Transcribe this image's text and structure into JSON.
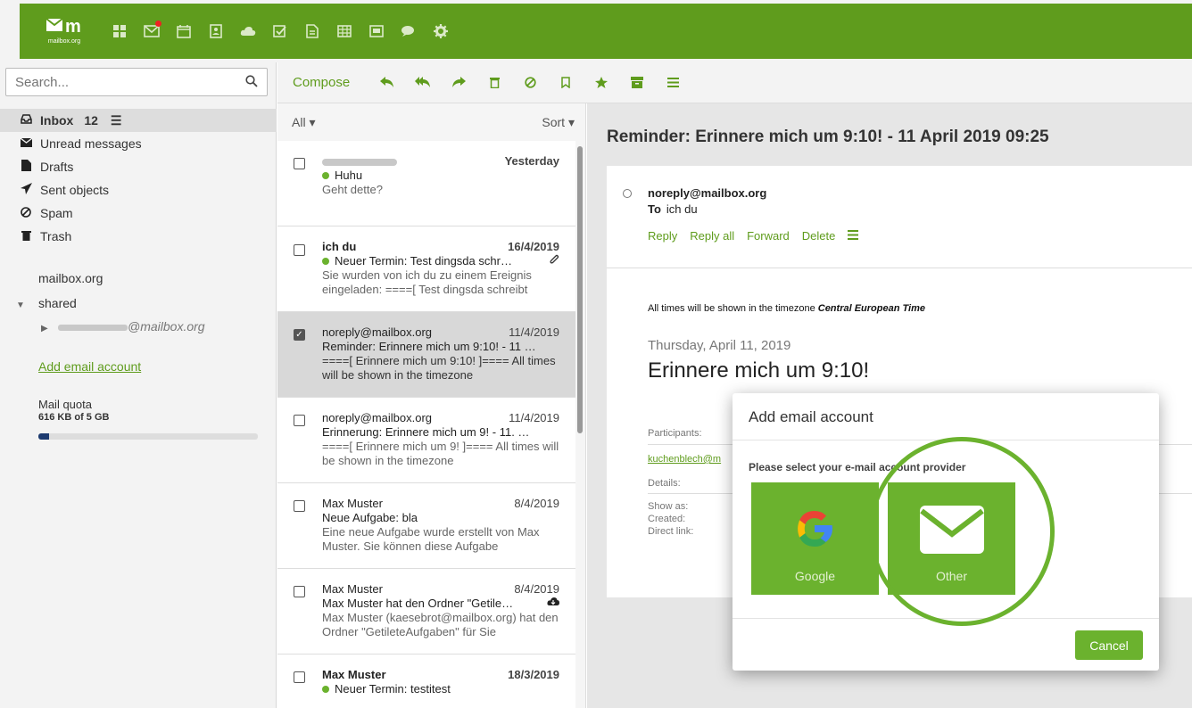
{
  "brand": {
    "mark": "m",
    "sub": "mailbox.org"
  },
  "search": {
    "placeholder": "Search..."
  },
  "folders": [
    {
      "label": "Inbox",
      "count": "12"
    },
    {
      "label": "Unread messages"
    },
    {
      "label": "Drafts"
    },
    {
      "label": "Sent objects"
    },
    {
      "label": "Spam"
    },
    {
      "label": "Trash"
    }
  ],
  "sidebar": {
    "account": "mailbox.org",
    "shared": "shared",
    "shared_account_suffix": "@mailbox.org",
    "add_account": "Add email account",
    "quota_label": "Mail quota",
    "quota_value": "616 KB of 5 GB",
    "quota_fraction": 0.05
  },
  "toolbar": {
    "compose": "Compose"
  },
  "list": {
    "filter": "All",
    "sort": "Sort",
    "mails": [
      {
        "from": "",
        "date": "Yesterday",
        "subject": "Huhu",
        "preview": "Geht dette?"
      },
      {
        "from": "ich du",
        "date": "16/4/2019",
        "subject": "Neuer Termin: Test dingsda schr…",
        "preview": "Sie wurden von ich du zu einem Ereignis eingeladen: ====[ Test dingsda schreibt"
      },
      {
        "from": "noreply@mailbox.org",
        "date": "11/4/2019",
        "subject": "Reminder: Erinnere mich um 9:10! - 11 …",
        "preview": "====[ Erinnere mich um 9:10! ]==== All times will be shown in the timezone"
      },
      {
        "from": "noreply@mailbox.org",
        "date": "11/4/2019",
        "subject": "Erinnerung: Erinnere mich um 9! - 11. …",
        "preview": "====[ Erinnere mich um 9! ]==== All times will be shown in the timezone"
      },
      {
        "from": "Max Muster",
        "date": "8/4/2019",
        "subject": "Neue Aufgabe: bla",
        "preview": "Eine neue Aufgabe wurde erstellt von Max Muster. Sie können diese Aufgabe"
      },
      {
        "from": "Max Muster",
        "date": "8/4/2019",
        "subject": "Max Muster hat den Ordner \"Getile…",
        "preview": "Max Muster (kaesebrot@mailbox.org) hat den Ordner \"GetileteAufgaben\" für Sie"
      },
      {
        "from": "Max Muster",
        "date": "18/3/2019",
        "subject": "Neuer Termin: testitest",
        "preview": ""
      }
    ]
  },
  "detail": {
    "title": "Reminder: Erinnere mich um 9:10! - 11 April 2019 09:25",
    "sender": "noreply@mailbox.org",
    "to_label": "To",
    "to": "ich du",
    "actions": [
      "Reply",
      "Reply all",
      "Forward",
      "Delete"
    ],
    "tz_text": "All times will be shown in the timezone ",
    "tz_name": "Central European Time",
    "event_day": "Thursday, April 11, 2019",
    "event_title": "Erinnere mich um 9:10!",
    "participants_label": "Participants:",
    "participant_link": "kuchenblech@m",
    "details_label": "Details:",
    "show_as": "Show as:",
    "created": "Created:",
    "direct_link": "Direct link:"
  },
  "dialog": {
    "title": "Add email account",
    "subtitle": "Please select your e-mail account provider",
    "google": "Google",
    "other": "Other",
    "cancel": "Cancel"
  },
  "colors": {
    "brand_green": "#5f9c1d",
    "tile_green": "#6bb22e",
    "quota_fill": "#1d3b70"
  }
}
